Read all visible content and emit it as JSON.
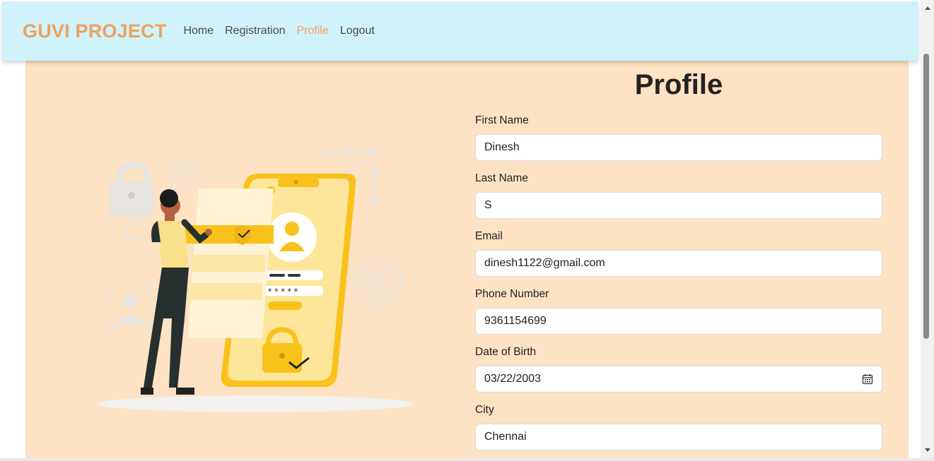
{
  "navbar": {
    "brand": "GUVI PROJECT",
    "links": [
      "Home",
      "Registration",
      "Profile",
      "Logout"
    ],
    "active_link": "Profile"
  },
  "profile": {
    "title": "Profile",
    "fields": [
      {
        "label": "First Name",
        "value": "Dinesh"
      },
      {
        "label": "Last Name",
        "value": "S"
      },
      {
        "label": "Email",
        "value": "dinesh1122@gmail.com"
      },
      {
        "label": "Phone Number",
        "value": "9361154699"
      },
      {
        "label": "Date of Birth",
        "value": "03/22/2003"
      },
      {
        "label": "City",
        "value": "Chennai"
      }
    ]
  },
  "illustration": {
    "password_mask": "*****"
  },
  "colors": {
    "navbar_bg": "#cff2fb",
    "brand": "#f0a05c",
    "content_bg": "#fde2c3",
    "illustration_yellow": "#f9c21b"
  }
}
